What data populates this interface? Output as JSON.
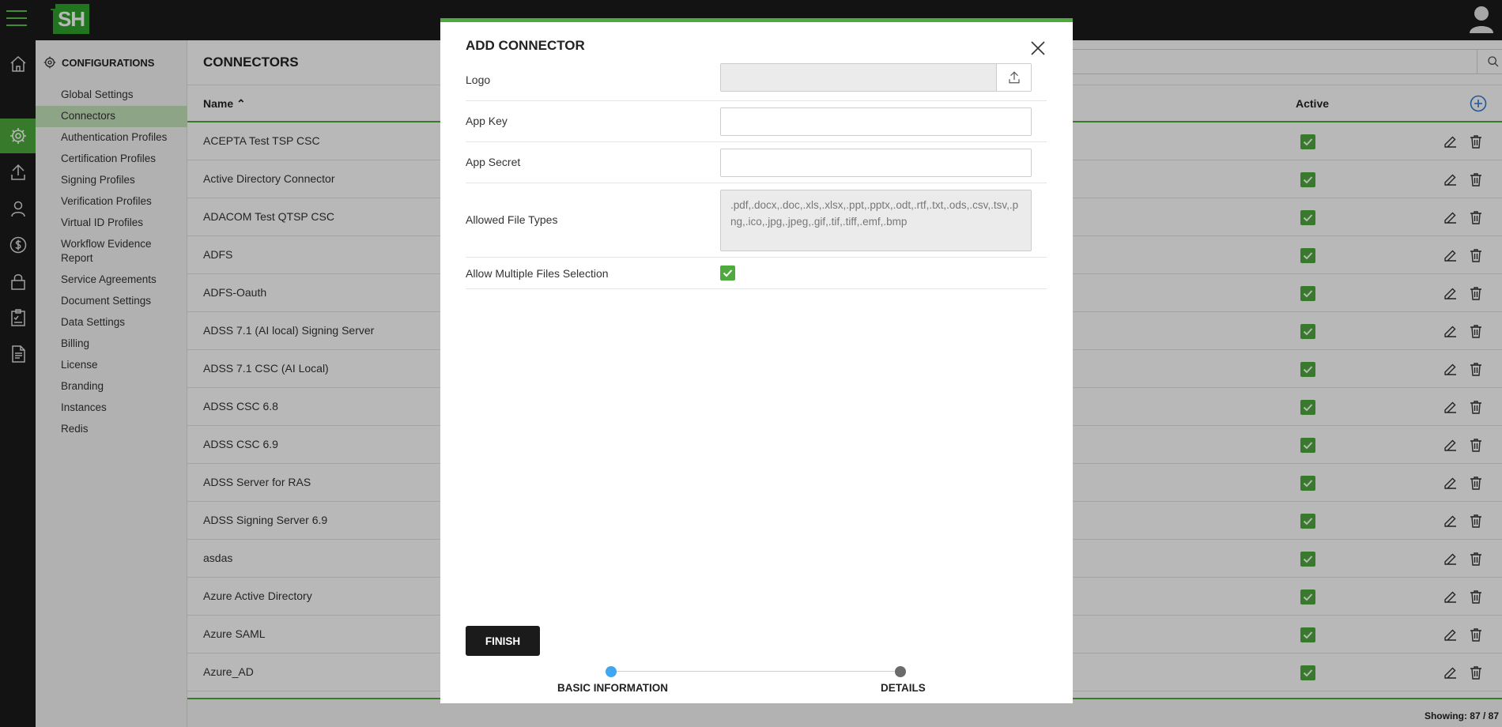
{
  "app": {
    "logo_text": "SH",
    "brand_color": "#4eaa3d"
  },
  "rail": {
    "items": [
      {
        "icon": "home-icon"
      },
      {
        "icon": "gear-icon",
        "active": true
      },
      {
        "icon": "upload-icon"
      },
      {
        "icon": "user-icon"
      },
      {
        "icon": "dollar-icon"
      },
      {
        "icon": "lock-icon"
      },
      {
        "icon": "clipboard-icon"
      },
      {
        "icon": "document-icon"
      }
    ]
  },
  "sidebar": {
    "title": "CONFIGURATIONS",
    "items": [
      {
        "label": "Global Settings"
      },
      {
        "label": "Connectors",
        "active": true
      },
      {
        "label": "Authentication Profiles"
      },
      {
        "label": "Certification Profiles"
      },
      {
        "label": "Signing Profiles"
      },
      {
        "label": "Verification Profiles"
      },
      {
        "label": "Virtual ID Profiles"
      },
      {
        "label": "Workflow Evidence Report"
      },
      {
        "label": "Service Agreements"
      },
      {
        "label": "Document Settings"
      },
      {
        "label": "Data Settings"
      },
      {
        "label": "Billing"
      },
      {
        "label": "License"
      },
      {
        "label": "Branding"
      },
      {
        "label": "Instances"
      },
      {
        "label": "Redis"
      }
    ]
  },
  "main": {
    "title": "CONNECTORS",
    "columns": {
      "name": "Name",
      "active": "Active"
    },
    "rows": [
      {
        "name": "ACEPTA Test TSP CSC",
        "active": true
      },
      {
        "name": "Active Directory Connector",
        "active": true
      },
      {
        "name": "ADACOM Test QTSP CSC",
        "active": true
      },
      {
        "name": "ADFS",
        "active": true
      },
      {
        "name": "ADFS-Oauth",
        "active": true
      },
      {
        "name": "ADSS 7.1 (AI local) Signing Server",
        "active": true
      },
      {
        "name": "ADSS 7.1 CSC (AI Local)",
        "active": true
      },
      {
        "name": "ADSS CSC 6.8",
        "active": true
      },
      {
        "name": "ADSS CSC 6.9",
        "active": true
      },
      {
        "name": "ADSS Server for RAS",
        "active": true
      },
      {
        "name": "ADSS Signing Server 6.9",
        "active": true
      },
      {
        "name": "asdas",
        "active": true
      },
      {
        "name": "Azure Active Directory",
        "active": true
      },
      {
        "name": "Azure SAML",
        "active": true
      },
      {
        "name": "Azure_AD",
        "active": true
      }
    ],
    "showing": "Showing: 87 / 87"
  },
  "modal": {
    "title": "ADD CONNECTOR",
    "fields": {
      "logo_label": "Logo",
      "app_key_label": "App Key",
      "app_key_value": "",
      "app_secret_label": "App Secret",
      "app_secret_value": "",
      "allowed_types_label": "Allowed File Types",
      "allowed_types_value": ".pdf,.docx,.doc,.xls,.xlsx,.ppt,.pptx,.odt,.rtf,.txt,.ods,.csv,.tsv,.png,.ico,.jpg,.jpeg,.gif,.tif,.tiff,.emf,.bmp",
      "allow_multiple_label": "Allow Multiple Files Selection",
      "allow_multiple_checked": true
    },
    "finish_label": "FINISH",
    "steps": [
      {
        "label": "BASIC INFORMATION",
        "state": "current",
        "color": "#3fa6f0"
      },
      {
        "label": "DETAILS",
        "state": "upcoming",
        "color": "#6b6b6b"
      }
    ]
  }
}
